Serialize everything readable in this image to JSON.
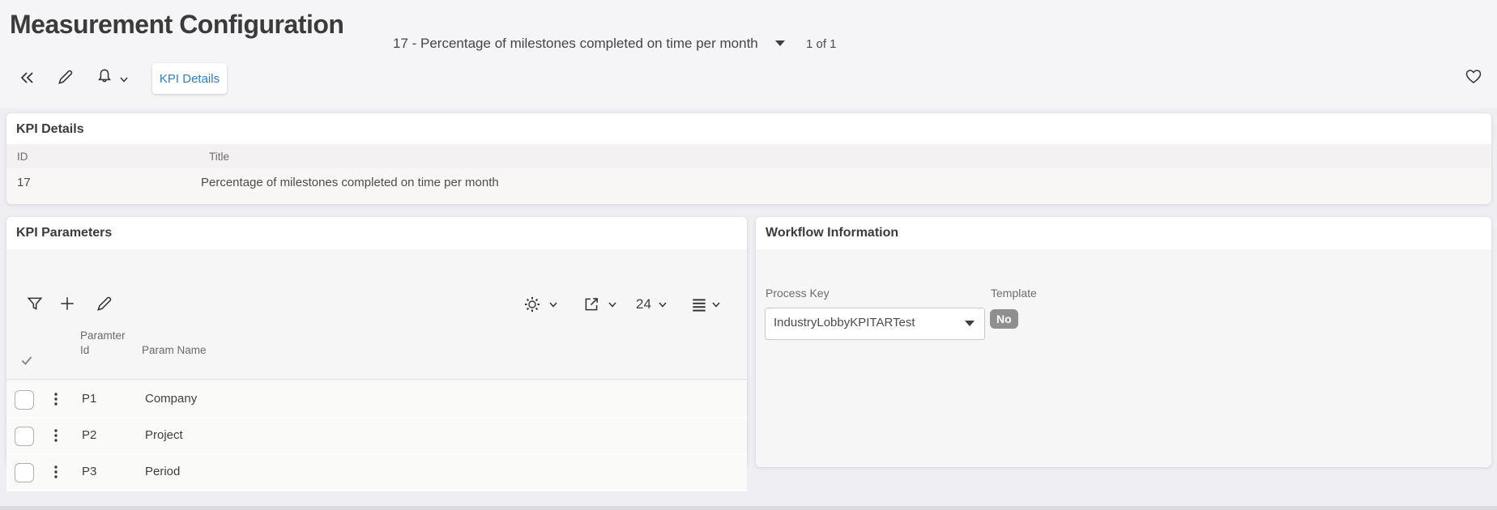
{
  "page": {
    "title": "Measurement Configuration",
    "record_selector": "17 - Percentage of milestones completed on time per month",
    "record_count": "1 of 1",
    "tab_label": "KPI Details"
  },
  "toolbar_icons": {
    "collapse": "double-chevron-left-icon",
    "edit": "pencil-icon",
    "alerts": "bell-icon",
    "favorite": "heart-icon"
  },
  "kpi_details": {
    "section_title": "KPI Details",
    "fields": [
      {
        "label": "ID",
        "value": "17"
      },
      {
        "label": "Title",
        "value": "Percentage of milestones completed on time per month"
      }
    ]
  },
  "kpi_parameters": {
    "section_title": "KPI Parameters",
    "page_size": "24",
    "columns": {
      "param_id": "Paramter Id",
      "param_name": "Param Name"
    },
    "rows": [
      {
        "param_id": "P1",
        "param_name": "Company"
      },
      {
        "param_id": "P2",
        "param_name": "Project"
      },
      {
        "param_id": "P3",
        "param_name": "Period"
      }
    ]
  },
  "workflow": {
    "section_title": "Workflow Information",
    "process_key_label": "Process Key",
    "process_key_value": "IndustryLobbyKPITARTest",
    "template_label": "Template",
    "template_value": "No"
  },
  "colors": {
    "accent_blue": "#2d7fc5",
    "badge_gray": "#8f8f8f",
    "header_bg": "#f5f4f6",
    "page_bg": "#efeef2"
  }
}
